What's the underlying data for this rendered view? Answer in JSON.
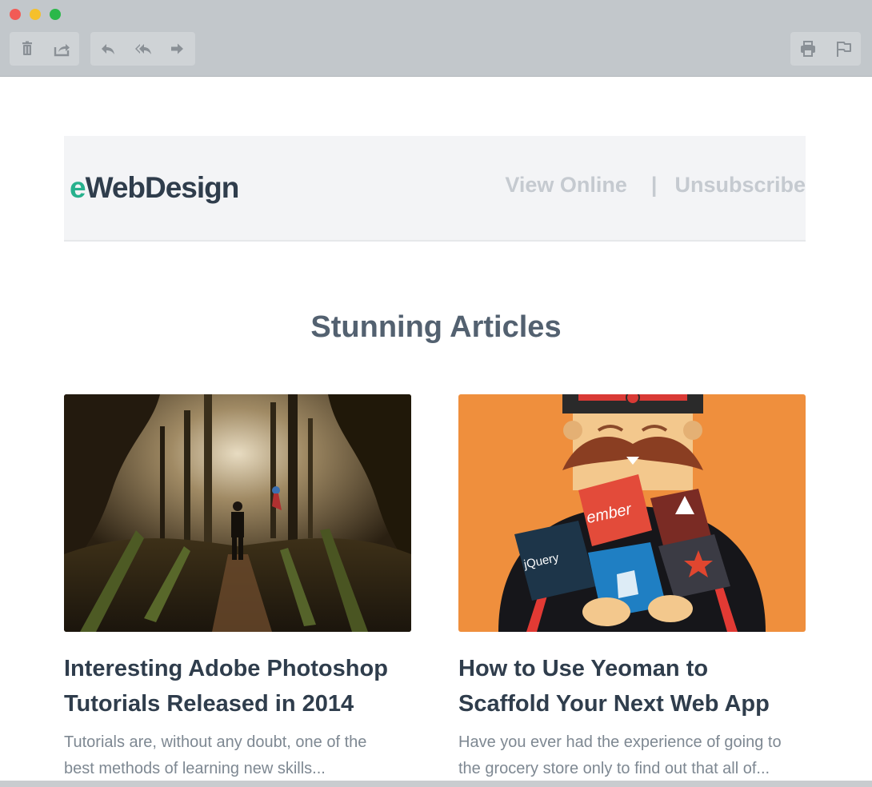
{
  "toolbar": {
    "left_group": [
      {
        "icon": "trash-icon"
      },
      {
        "icon": "share-icon"
      }
    ],
    "mid_group": [
      {
        "icon": "reply-icon"
      },
      {
        "icon": "reply-all-icon"
      },
      {
        "icon": "forward-icon"
      }
    ],
    "right_group": [
      {
        "icon": "print-icon"
      },
      {
        "icon": "flag-icon"
      }
    ],
    "traffic_lights": [
      "#f25b56",
      "#f5c02b",
      "#2bb84a"
    ]
  },
  "header": {
    "logo_prefix": "e",
    "logo_rest": "WebDesign",
    "logo_colors": {
      "prefix": "#27b18d",
      "rest": "#2f3d4c"
    },
    "view_online": "View Online",
    "separator": "|",
    "unsubscribe": "Unsubscribe"
  },
  "section": {
    "title": "Stunning Articles"
  },
  "articles": [
    {
      "title_line1": "Interesting Adobe Photoshop",
      "title_line2": "Tutorials Released in 2014",
      "excerpt_line1": "Tutorials are, without any doubt, one of the",
      "excerpt_line2": "best methods of learning new skills...",
      "image": "forest-photo-manipulation"
    },
    {
      "title_line1": "How to Use Yeoman to",
      "title_line2": "Scaffold Your Next Web App",
      "excerpt_line1": "Have you ever had the experience of going to",
      "excerpt_line2": "the grocery store only to find out that all of...",
      "image": "yeoman-mascot-illustration",
      "image_labels": [
        "ember",
        "jQuery"
      ]
    }
  ]
}
